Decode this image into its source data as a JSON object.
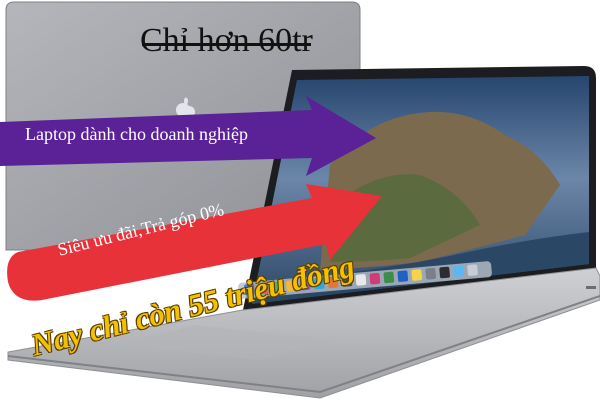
{
  "ad": {
    "old_price": "Chỉ hơn 60tr",
    "banner_purple": "Laptop dành cho doanh nghiệp",
    "banner_red": "Siêu ưu đãi,Trả góp 0%",
    "new_price": "Nay chỉ còn 55 triệu đồng"
  },
  "colors": {
    "purple_arrow": "#5b2196",
    "red_arrow": "#e8323a",
    "laptop_gray": "#9a9ca1",
    "price_yellow": "#f2c200"
  },
  "icons": [
    "apple-logo-icon",
    "dock-icons"
  ]
}
